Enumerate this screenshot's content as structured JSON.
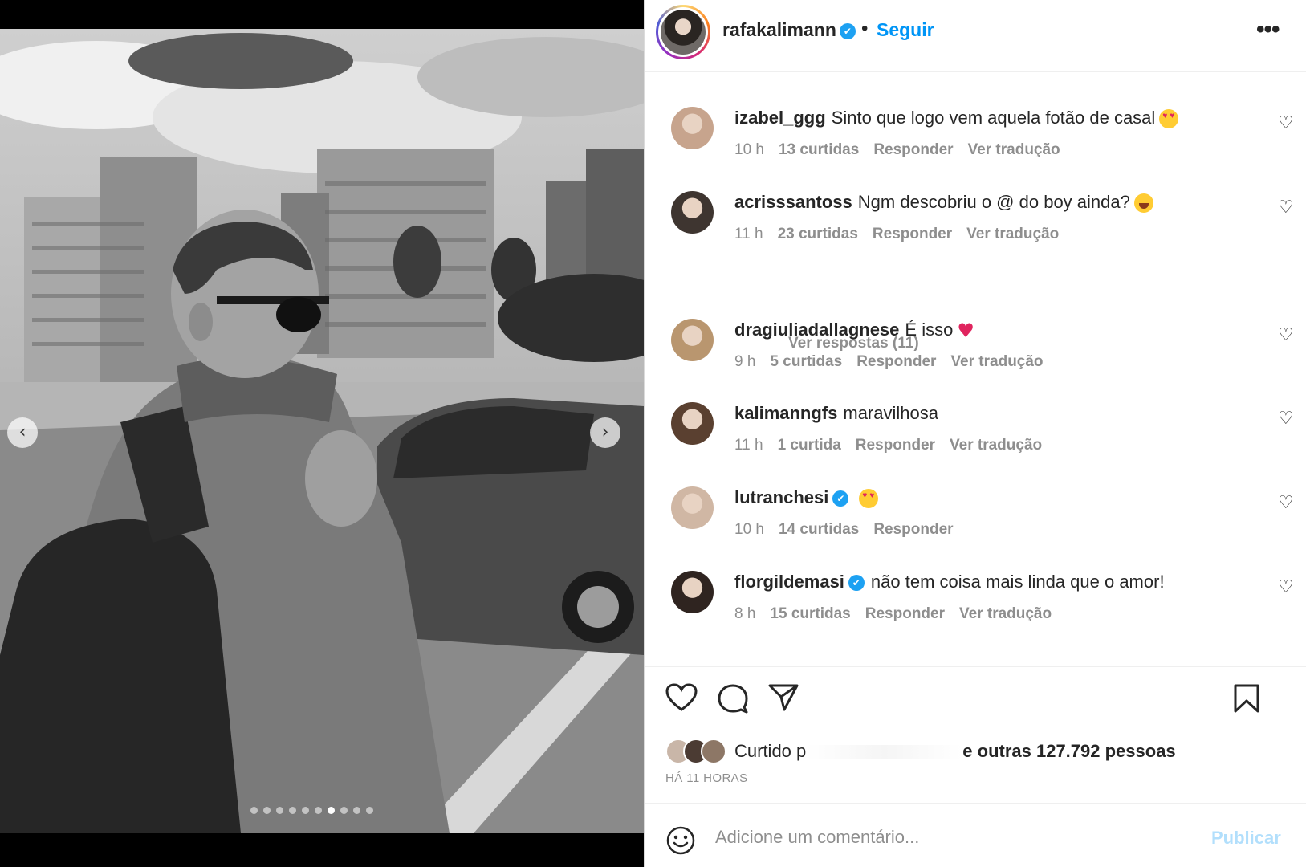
{
  "post": {
    "username": "rafakalimann",
    "separator": "•",
    "follow_label": "Seguir",
    "more_label": "•••",
    "carousel": {
      "total": 10,
      "active_index": 6
    }
  },
  "comments": [
    {
      "username": "izabel_ggg",
      "text": "Sinto que logo vem aquela fotão de casal",
      "emoji": "smiling-face-with-heart-eyes",
      "verified": false,
      "time": "10 h",
      "likes": "13 curtidas",
      "reply": "Responder",
      "translate": "Ver tradução"
    },
    {
      "username": "acrisssantoss",
      "text": "Ngm descobriu o @ do boy ainda?",
      "emoji": "face-with-tears-of-joy",
      "verified": false,
      "time": "11 h",
      "likes": "23 curtidas",
      "reply": "Responder",
      "translate": "Ver tradução"
    },
    {
      "username": "dragiuliadallagnese",
      "text": "É isso",
      "emoji": "red-heart",
      "verified": false,
      "time": "9 h",
      "likes": "5 curtidas",
      "reply": "Responder",
      "translate": "Ver tradução"
    },
    {
      "username": "kalimanngfs",
      "text": "maravilhosa",
      "emoji": "",
      "verified": false,
      "time": "11 h",
      "likes": "1 curtida",
      "reply": "Responder",
      "translate": "Ver tradução"
    },
    {
      "username": "lutranchesi",
      "text": "",
      "emoji": "smiling-face-with-heart-eyes",
      "verified": true,
      "time": "10 h",
      "likes": "14 curtidas",
      "reply": "Responder",
      "translate": ""
    },
    {
      "username": "florgildemasi",
      "text": "não tem coisa mais linda que o amor!",
      "emoji": "",
      "verified": true,
      "time": "8 h",
      "likes": "15 curtidas",
      "reply": "Responder",
      "translate": "Ver tradução"
    }
  ],
  "view_replies": "Ver respostas (11)",
  "likes": {
    "prefix": "Curtido p",
    "suffix": "e outras 127.792 pessoas"
  },
  "timestamp": "HÁ 11 HORAS",
  "add_comment": {
    "placeholder": "Adicione um comentário...",
    "publish_label": "Publicar"
  },
  "colors": {
    "link_blue": "#0095f6",
    "verified_blue": "#1da1f2",
    "muted_text": "#8e8e8e",
    "publish_disabled": "#b2dffc"
  },
  "icons": [
    "chevron-left-icon",
    "chevron-right-icon",
    "verified-badge-icon",
    "more-options-icon",
    "heart-icon",
    "comment-icon",
    "share-icon",
    "bookmark-icon",
    "emoji-smiley-icon"
  ]
}
